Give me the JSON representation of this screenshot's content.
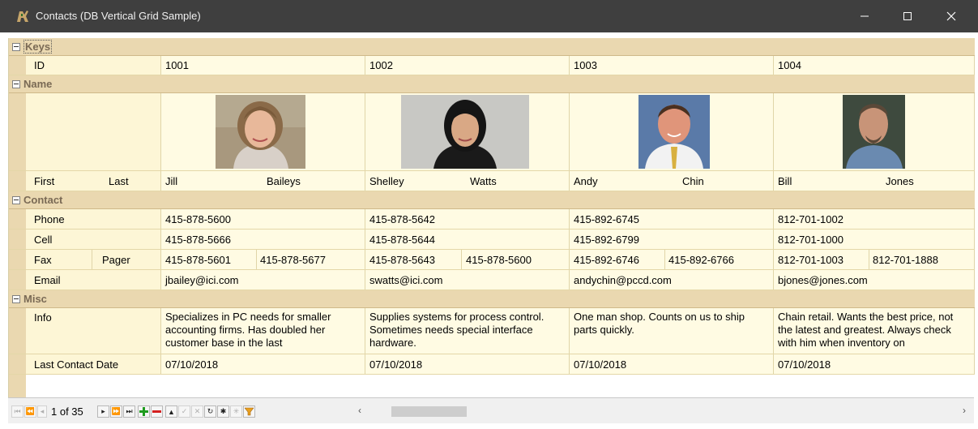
{
  "window": {
    "title": "Contacts (DB Vertical Grid Sample)",
    "minimize_glyph": "—",
    "maximize_glyph": "☐",
    "close_glyph": "✕"
  },
  "categories": {
    "keys": "Keys",
    "name": "Name",
    "contact": "Contact",
    "misc": "Misc"
  },
  "row_labels": {
    "id": "ID",
    "first": "First",
    "last": "Last",
    "phone": "Phone",
    "cell": "Cell",
    "fax": "Fax",
    "pager": "Pager",
    "email": "Email",
    "info": "Info",
    "last_contact_date": "Last Contact Date"
  },
  "records": [
    {
      "id": "1001",
      "first": "Jill",
      "last": "Baileys",
      "phone": "415-878-5600",
      "cell": "415-878-5666",
      "fax": "415-878-5601",
      "pager": "415-878-5677",
      "email": "jbailey@ici.com",
      "info": "Specializes in PC needs for smaller accounting firms. Has doubled her customer base in the last",
      "last_contact_date": "07/10/2018",
      "photo": "woman-curly-hair-portrait"
    },
    {
      "id": "1002",
      "first": "Shelley",
      "last": "Watts",
      "phone": "415-878-5642",
      "cell": "415-878-5644",
      "fax": "415-878-5643",
      "pager": "415-878-5600",
      "email": "swatts@ici.com",
      "info": "Supplies systems for process control. Sometimes needs special interface hardware.",
      "last_contact_date": "07/10/2018",
      "photo": "woman-dark-hair-portrait"
    },
    {
      "id": "1003",
      "first": "Andy",
      "last": "Chin",
      "phone": "415-892-6745",
      "cell": "415-892-6799",
      "fax": "415-892-6746",
      "pager": "415-892-6766",
      "email": "andychin@pccd.com",
      "info": "One man shop. Counts on us to ship parts quickly.",
      "last_contact_date": "07/10/2018",
      "photo": "man-tie-portrait"
    },
    {
      "id": "1004",
      "first": "Bill",
      "last": "Jones",
      "phone": "812-701-1002",
      "cell": "812-701-1000",
      "fax": "812-701-1003",
      "pager": "812-701-1888",
      "email": "bjones@jones.com",
      "info": "Chain retail. Wants the best price, not the latest and greatest. Always check with him when inventory on",
      "last_contact_date": "07/10/2018",
      "photo": "man-goatee-portrait"
    }
  ],
  "navigator": {
    "position": "1 of 35",
    "buttons": [
      "first",
      "prior-page",
      "prior",
      "next",
      "next-page",
      "last",
      "insert",
      "delete",
      "edit",
      "post",
      "cancel",
      "refresh",
      "save-bookmark",
      "goto-bookmark",
      "filter"
    ]
  },
  "colors": {
    "category_band": "#ead8b0",
    "cell_bg": "#fffbe3",
    "title_bar": "#3f3f3f",
    "insert_green": "#1e9b1e",
    "delete_red": "#d42020"
  }
}
